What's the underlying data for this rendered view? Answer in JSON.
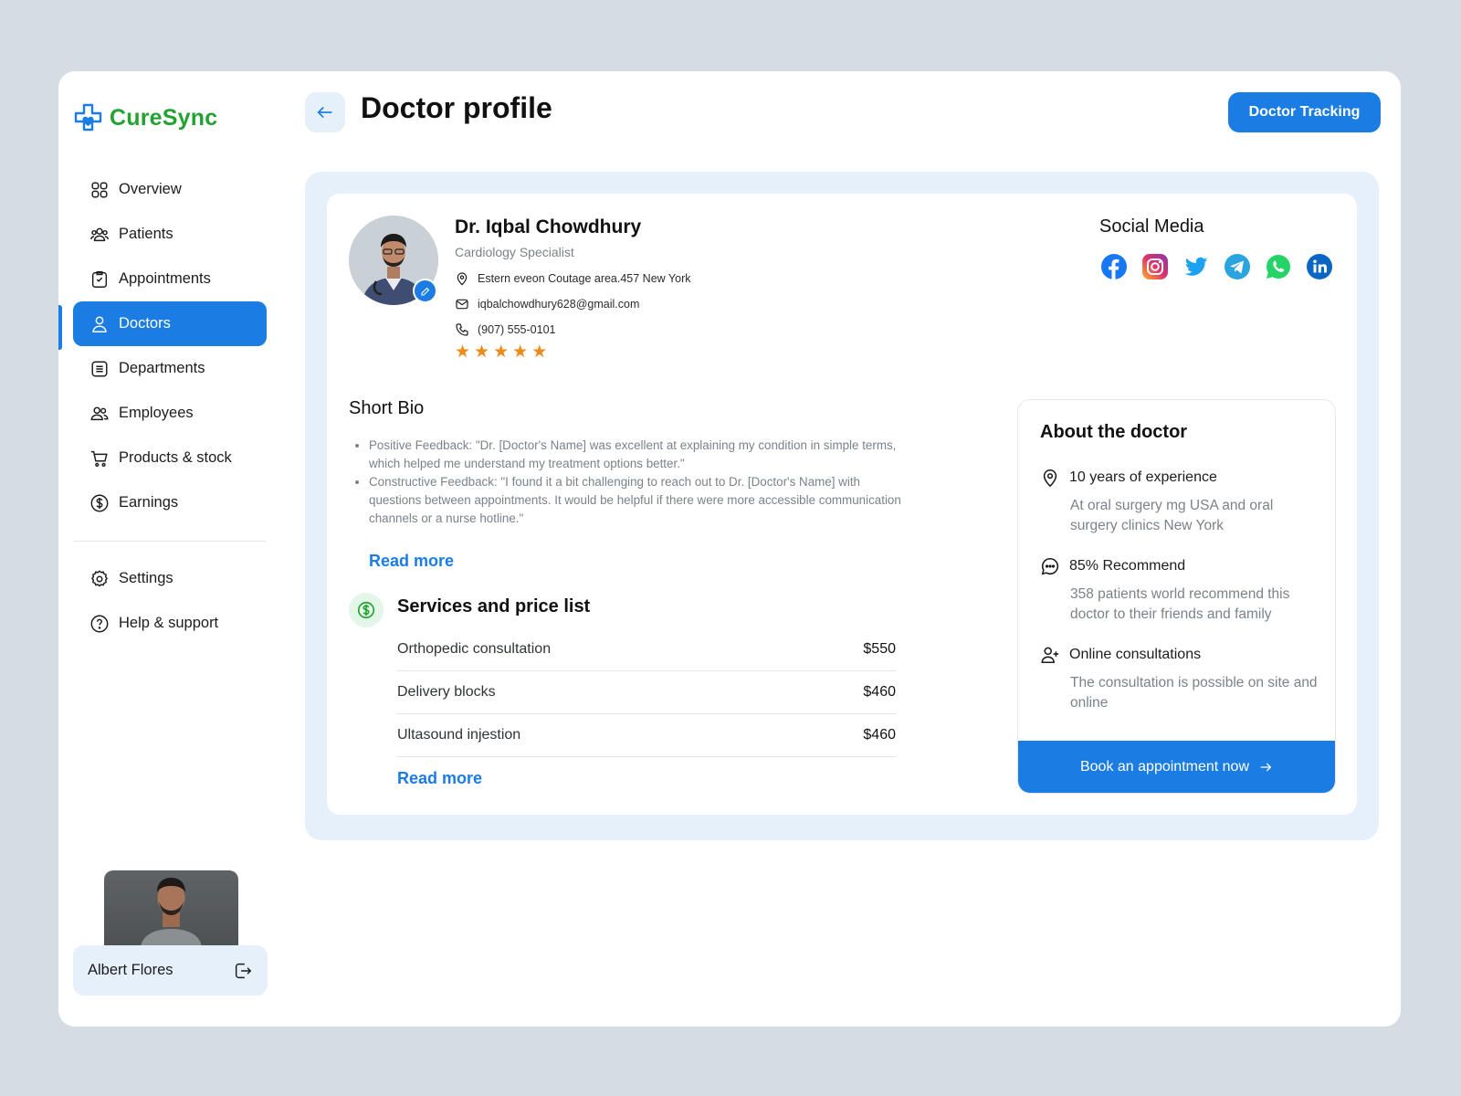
{
  "app": {
    "name": "CureSync"
  },
  "colors": {
    "brand_green": "#22a230",
    "accent_blue": "#1b7de3",
    "star": "#ed8b1a"
  },
  "sidebar": {
    "items": [
      {
        "label": "Overview",
        "icon": "grid-icon"
      },
      {
        "label": "Patients",
        "icon": "users-icon"
      },
      {
        "label": "Appointments",
        "icon": "clipboard-icon"
      },
      {
        "label": "Doctors",
        "icon": "user-icon",
        "active": true
      },
      {
        "label": "Departments",
        "icon": "list-icon"
      },
      {
        "label": "Employees",
        "icon": "users-icon"
      },
      {
        "label": "Products & stock",
        "icon": "cart-icon"
      },
      {
        "label": "Earnings",
        "icon": "dollar-icon"
      }
    ],
    "secondary": [
      {
        "label": "Settings",
        "icon": "gear-icon"
      },
      {
        "label": "Help & support",
        "icon": "help-icon"
      }
    ],
    "user": {
      "name": "Albert Flores"
    }
  },
  "header": {
    "title": "Doctor profile",
    "tracking_label": "Doctor Tracking"
  },
  "doctor": {
    "name": "Dr. Iqbal Chowdhury",
    "specialty": "Cardiology Specialist",
    "address": "Estern eveon Coutage area.457  New York",
    "email": "iqbalchowdhury628@gmail.com",
    "phone": "(907) 555-0101",
    "rating": 5
  },
  "social": {
    "title": "Social Media",
    "icons": [
      "facebook-icon",
      "instagram-icon",
      "twitter-icon",
      "telegram-icon",
      "whatsapp-icon",
      "linkedin-icon"
    ]
  },
  "bio": {
    "title": "Short Bio",
    "items": [
      "Positive Feedback: \"Dr. [Doctor's Name] was excellent at explaining my condition in simple terms, which helped me understand my treatment options better.\"",
      "Constructive Feedback: \"I found it a bit challenging to reach out to Dr. [Doctor's Name] with questions between appointments. It would be helpful if there were more accessible communication channels or a nurse hotline.\""
    ],
    "read_more": "Read more"
  },
  "services": {
    "title": "Services and price list",
    "rows": [
      {
        "name": "Orthopedic consultation",
        "price": "$550"
      },
      {
        "name": "Delivery blocks",
        "price": "$460"
      },
      {
        "name": "Ultasound injestion",
        "price": "$460"
      }
    ],
    "read_more": "Read more"
  },
  "about": {
    "title": "About the doctor",
    "items": [
      {
        "title": "10 years of experience",
        "desc": "At  oral surgery mg USA and oral surgery clinics New York",
        "icon": "location-icon"
      },
      {
        "title": "85% Recommend",
        "desc": "358 patients world recommend this doctor to their friends and family",
        "icon": "chat-icon"
      },
      {
        "title": "Online consultations",
        "desc": "The consultation is possible on site and online",
        "icon": "user-plus-icon"
      }
    ],
    "book_label": "Book an appointment now"
  }
}
